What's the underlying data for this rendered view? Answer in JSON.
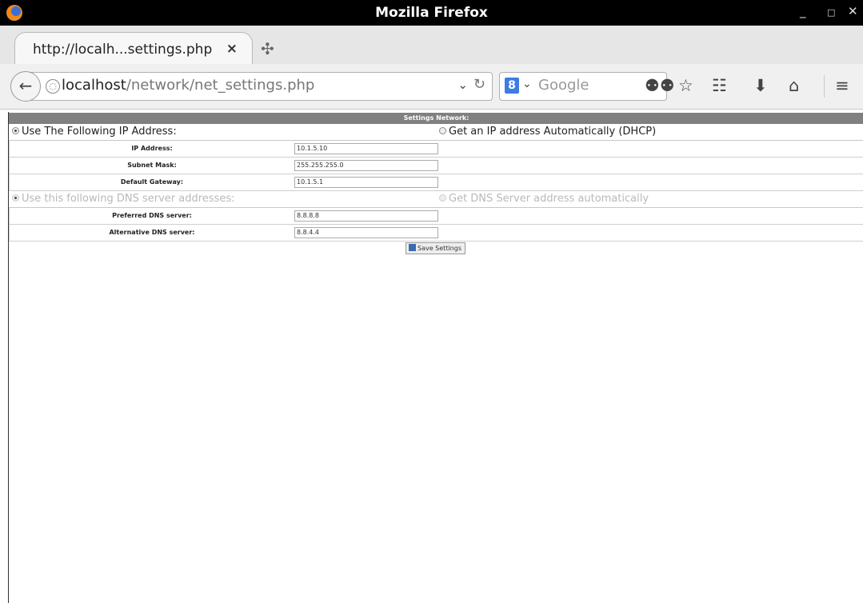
{
  "window": {
    "title": "Mozilla Firefox",
    "controls": {
      "minimize": "_",
      "maximize": "□",
      "close": "✕"
    }
  },
  "tabs": [
    {
      "label": "http://localh...settings.php",
      "close": "×"
    }
  ],
  "nav": {
    "url_host": "localhost",
    "url_path": "/network/net_settings.php",
    "search_placeholder": "Google",
    "search_engine_icon": "8"
  },
  "page": {
    "header": "Settings Network:",
    "ip_options": {
      "static_label": "Use The Following IP Address:",
      "dhcp_label": "Get an IP address Automatically (DHCP)",
      "selected": "static"
    },
    "ip_fields": [
      {
        "label": "IP Address:",
        "value": "10.1.5.10"
      },
      {
        "label": "Subnet Mask:",
        "value": "255.255.255.0"
      },
      {
        "label": "Default Gateway:",
        "value": "10.1.5.1"
      }
    ],
    "dns_options": {
      "static_label": "Use this following DNS server addresses:",
      "auto_label": "Get DNS Server address automatically",
      "selected": "static",
      "disabled": true
    },
    "dns_fields": [
      {
        "label": "Preferred DNS server:",
        "value": "8.8.8.8"
      },
      {
        "label": "Alternative DNS server:",
        "value": "8.8.4.4"
      }
    ],
    "save_label": "Save Settings"
  }
}
